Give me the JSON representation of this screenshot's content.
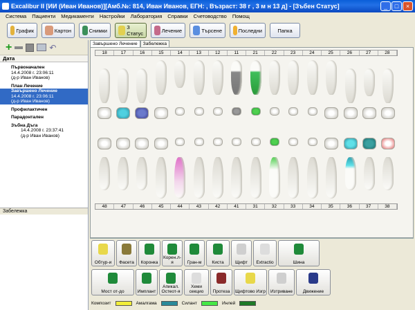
{
  "window": {
    "title": "Excalibur II [ИИ (Иван Иванов)][Амб.№: 814, Иван Иванов, ЕГН: , Възраст: 38 г , 3 м н 13 д] - [Зъбен Статус]",
    "min_label": "_",
    "max_label": "□",
    "close_label": "×"
  },
  "menu": [
    "Система",
    "Пациенти",
    "Медикаменти",
    "Настройки",
    "Лаборатория",
    "Справки",
    "Счетоводство",
    "Помощ"
  ],
  "toolbar": [
    {
      "label": "График",
      "icon": "calendar-icon",
      "color": "#e3b23c"
    },
    {
      "label": "Картон",
      "icon": "patient-icon",
      "color": "#d99a7a"
    },
    {
      "label": "Снимки",
      "icon": "xray-icon",
      "color": "#3b8f5a"
    },
    {
      "label": "З Статус",
      "icon": "tooth-icon",
      "color": "#e2d050",
      "active": true
    },
    {
      "label": "Лечение",
      "icon": "treatment-icon",
      "color": "#c46a8a"
    },
    {
      "label": "Търсене",
      "icon": "search-icon",
      "color": "#5a8ee0"
    },
    {
      "label": "Последни",
      "icon": "star-icon",
      "color": "#f0b030"
    },
    {
      "label": "Папка",
      "icon": "",
      "color": ""
    }
  ],
  "left": {
    "date_header": "Дата",
    "tree": [
      {
        "kind": "grp",
        "text": "Първоначален"
      },
      {
        "kind": "ent",
        "text": "14.4.2008 г. 23:06:11"
      },
      {
        "kind": "ent",
        "text": "(д-р Иван Иванов)"
      },
      {
        "kind": "grp",
        "text": "План Лечение"
      },
      {
        "kind": "sel",
        "text": "Завършено Лечение"
      },
      {
        "kind": "sel",
        "text": "14.4.2008 г. 23:06:11"
      },
      {
        "kind": "sel",
        "text": "(д-р Иван Иванов)"
      },
      {
        "kind": "grp",
        "text": "Профилактичен"
      },
      {
        "kind": "grp",
        "text": "Парадонтален"
      },
      {
        "kind": "grp",
        "text": "Зъбна Дъга"
      },
      {
        "kind": "sub",
        "text": "14.4.2008 г. 23:37:41"
      },
      {
        "kind": "sub",
        "text": "(д-р Иван Иванов)"
      }
    ],
    "note_header": "Забележка"
  },
  "tabs": [
    "Завършено Лечение",
    "Забележка"
  ],
  "teeth_upper": [
    "18",
    "17",
    "16",
    "15",
    "14",
    "13",
    "12",
    "11",
    "21",
    "22",
    "23",
    "24",
    "25",
    "26",
    "27",
    "28"
  ],
  "teeth_lower": [
    "48",
    "47",
    "46",
    "45",
    "44",
    "43",
    "42",
    "41",
    "31",
    "32",
    "33",
    "34",
    "35",
    "36",
    "37",
    "38"
  ],
  "actions_row1": [
    {
      "label": "Обтур-и",
      "color": "#e8d84a"
    },
    {
      "label": "Фасета",
      "color": "#8a7a3a"
    },
    {
      "label": "Коронка",
      "color": "#1f8a3a"
    },
    {
      "label": "Корен.л-я",
      "color": "#1f8a3a"
    },
    {
      "label": "Гран-м",
      "color": "#1f8a3a"
    },
    {
      "label": "Киста",
      "color": "#1f8a3a"
    },
    {
      "label": "Щифт",
      "color": "#cfcfcf"
    },
    {
      "label": "Extractio",
      "color": "#dddddd"
    },
    {
      "label": "Шина",
      "color": "#1f8a3a"
    }
  ],
  "actions_row2": [
    {
      "label": "Мост от-до",
      "color": "#1f8a3a"
    },
    {
      "label": "Имплант",
      "color": "#1f8a3a"
    },
    {
      "label": "Апикал. Остеот-я",
      "color": "#1f8a3a"
    },
    {
      "label": "Хеми секцио",
      "color": "#dddddd"
    },
    {
      "label": "Протеза",
      "color": "#8a2a2a"
    },
    {
      "label": "Щифтово Изгр",
      "color": "#e8d84a"
    },
    {
      "label": "Изтриване",
      "color": "#cfcfcf"
    },
    {
      "label": "Движение",
      "color": "#2a3a8a"
    }
  ],
  "legend": [
    {
      "label": "Композит",
      "color": "#f2ee3a"
    },
    {
      "label": "Амалгама",
      "color": "#2a8a9a"
    },
    {
      "label": "Силант",
      "color": "#46e846"
    },
    {
      "label": "Инлей",
      "color": "#1e7a28"
    }
  ]
}
